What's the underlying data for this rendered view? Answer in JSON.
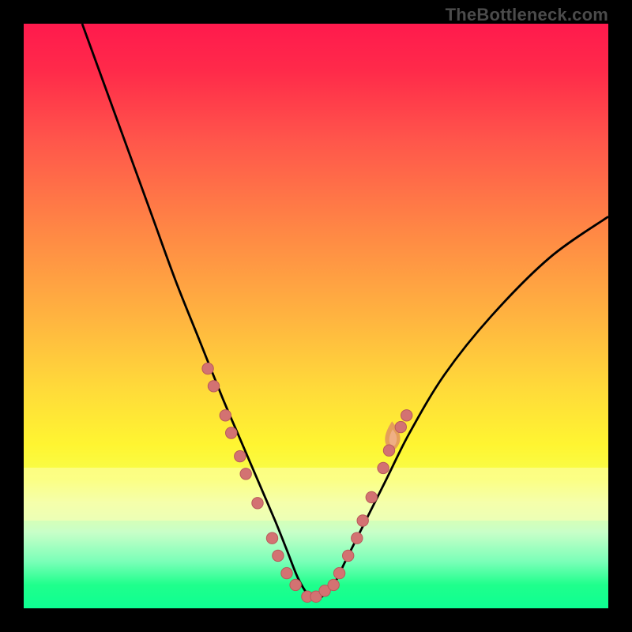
{
  "attribution": "TheBottleneck.com",
  "colors": {
    "frame_bg_top": "#ff1a4d",
    "frame_bg_bottom": "#0dff92",
    "curve_stroke": "#000000",
    "marker_fill": "#d37272",
    "marker_stroke": "#b85a5a",
    "flame": "#e09060"
  },
  "chart_data": {
    "type": "line",
    "title": "",
    "xlabel": "",
    "ylabel": "",
    "xlim": [
      0,
      100
    ],
    "ylim": [
      0,
      100
    ],
    "grid": false,
    "legend": false,
    "series": [
      {
        "name": "bottleneck-curve",
        "x": [
          10,
          14,
          18,
          22,
          26,
          30,
          34,
          37,
          40,
          43,
          45,
          47,
          49,
          51,
          53,
          55,
          58,
          62,
          66,
          72,
          80,
          90,
          100
        ],
        "y": [
          100,
          89,
          78,
          67,
          56,
          46,
          36,
          29,
          22,
          15,
          10,
          5,
          2,
          2,
          4,
          8,
          14,
          22,
          30,
          40,
          50,
          60,
          67
        ]
      }
    ],
    "markers": [
      {
        "x": 31.5,
        "y": 41
      },
      {
        "x": 32.5,
        "y": 38
      },
      {
        "x": 34.5,
        "y": 33
      },
      {
        "x": 35.5,
        "y": 30
      },
      {
        "x": 37.0,
        "y": 26
      },
      {
        "x": 38.0,
        "y": 23
      },
      {
        "x": 40.0,
        "y": 18
      },
      {
        "x": 42.5,
        "y": 12
      },
      {
        "x": 43.5,
        "y": 9
      },
      {
        "x": 45.0,
        "y": 6
      },
      {
        "x": 46.5,
        "y": 4
      },
      {
        "x": 48.5,
        "y": 2
      },
      {
        "x": 50.0,
        "y": 2
      },
      {
        "x": 51.5,
        "y": 3
      },
      {
        "x": 53.0,
        "y": 4
      },
      {
        "x": 54.0,
        "y": 6
      },
      {
        "x": 55.5,
        "y": 9
      },
      {
        "x": 57.0,
        "y": 12
      },
      {
        "x": 58.0,
        "y": 15
      },
      {
        "x": 59.5,
        "y": 19
      },
      {
        "x": 61.5,
        "y": 24
      },
      {
        "x": 62.5,
        "y": 27
      },
      {
        "x": 64.5,
        "y": 31
      },
      {
        "x": 65.5,
        "y": 33
      }
    ],
    "flame_marker": {
      "x": 63,
      "y": 29
    },
    "yellow_band": {
      "y_from": 15,
      "y_to": 24
    }
  }
}
